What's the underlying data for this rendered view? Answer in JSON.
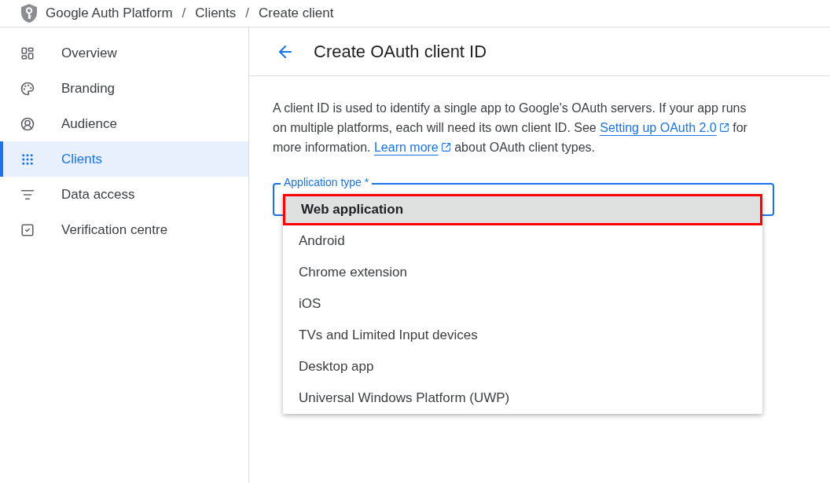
{
  "breadcrumb": [
    {
      "kind": "crumb",
      "text": "Google Auth Platform"
    },
    {
      "kind": "separator",
      "text": "/"
    },
    {
      "kind": "crumb",
      "text": "Clients"
    },
    {
      "kind": "separator",
      "text": "/"
    },
    {
      "kind": "crumb",
      "text": "Create client"
    }
  ],
  "sidebar": {
    "items": [
      {
        "label": "Overview",
        "selected": false
      },
      {
        "label": "Branding",
        "selected": false
      },
      {
        "label": "Audience",
        "selected": false
      },
      {
        "label": "Clients",
        "selected": true
      },
      {
        "label": "Data access",
        "selected": false
      },
      {
        "label": "Verification centre",
        "selected": false
      }
    ]
  },
  "page": {
    "title": "Create OAuth client ID",
    "description": [
      {
        "kind": "text",
        "text": "A client ID is used to identify a single app to Google's OAuth servers. If your app runs on multiple platforms, each will need its own client ID. See "
      },
      {
        "kind": "link",
        "text": "Setting up OAuth 2.0"
      },
      {
        "kind": "text",
        "text": " for more information. "
      },
      {
        "kind": "link",
        "text": "Learn more"
      },
      {
        "kind": "text",
        "text": " about OAuth client types."
      }
    ],
    "field": {
      "label": "Application type *",
      "options": [
        {
          "label": "Web application",
          "selected": true,
          "highlighted": true
        },
        {
          "label": "Android",
          "selected": false,
          "highlighted": false
        },
        {
          "label": "Chrome extension",
          "selected": false,
          "highlighted": false
        },
        {
          "label": "iOS",
          "selected": false,
          "highlighted": false
        },
        {
          "label": "TVs and Limited Input devices",
          "selected": false,
          "highlighted": false
        },
        {
          "label": "Desktop app",
          "selected": false,
          "highlighted": false
        },
        {
          "label": "Universal Windows Platform (UWP)",
          "selected": false,
          "highlighted": false
        }
      ]
    }
  }
}
